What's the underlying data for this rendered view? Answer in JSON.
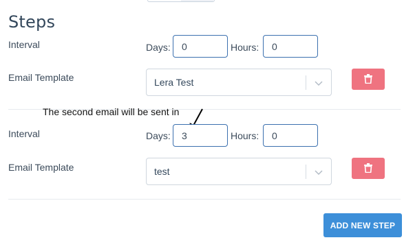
{
  "section_title": "Steps",
  "steps": [
    {
      "interval_label": "Interval",
      "days_label": "Days:",
      "days_value": "0",
      "hours_label": "Hours:",
      "hours_value": "0",
      "template_label": "Email Template",
      "template_value": "Lera Test"
    },
    {
      "interval_label": "Interval",
      "days_label": "Days:",
      "days_value": "3",
      "hours_label": "Hours:",
      "hours_value": "0",
      "template_label": "Email Template",
      "template_value": "test"
    }
  ],
  "annotation": "The second email will be sent in",
  "add_step_label": "ADD NEW STEP",
  "icons": {
    "delete": "trash-icon",
    "dropdown": "chevron-down-icon",
    "annotation_arrow": "arrow-icon"
  },
  "colors": {
    "delete_button": "#ef7380",
    "add_button": "#3d8fd9",
    "input_border": "#3a6fae",
    "title": "#33475b"
  }
}
